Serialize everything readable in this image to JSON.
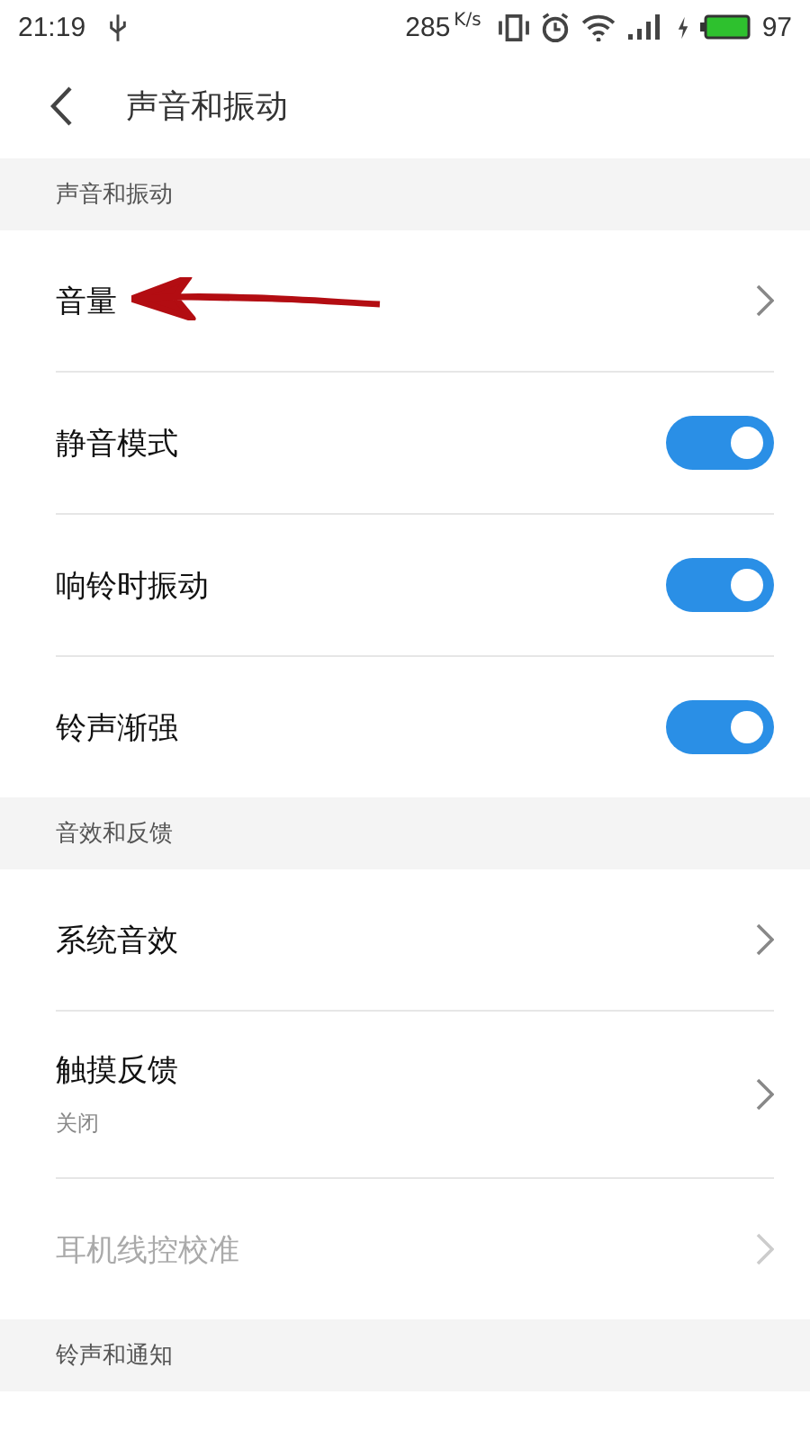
{
  "status_bar": {
    "time": "21:19",
    "speed": "285",
    "speed_unit": "K/s",
    "battery": "97"
  },
  "header": {
    "title": "声音和振动"
  },
  "sections": [
    {
      "title": "声音和振动",
      "rows": [
        {
          "kind": "link",
          "label": "音量",
          "disabled": false,
          "annotated": true
        },
        {
          "kind": "toggle",
          "label": "静音模式",
          "on": true
        },
        {
          "kind": "toggle",
          "label": "响铃时振动",
          "on": true
        },
        {
          "kind": "toggle",
          "label": "铃声渐强",
          "on": true
        }
      ]
    },
    {
      "title": "音效和反馈",
      "rows": [
        {
          "kind": "link",
          "label": "系统音效",
          "disabled": false
        },
        {
          "kind": "link",
          "label": "触摸反馈",
          "subtitle": "关闭",
          "disabled": false
        },
        {
          "kind": "link",
          "label": "耳机线控校准",
          "disabled": true
        }
      ]
    },
    {
      "title": "铃声和通知"
    }
  ]
}
